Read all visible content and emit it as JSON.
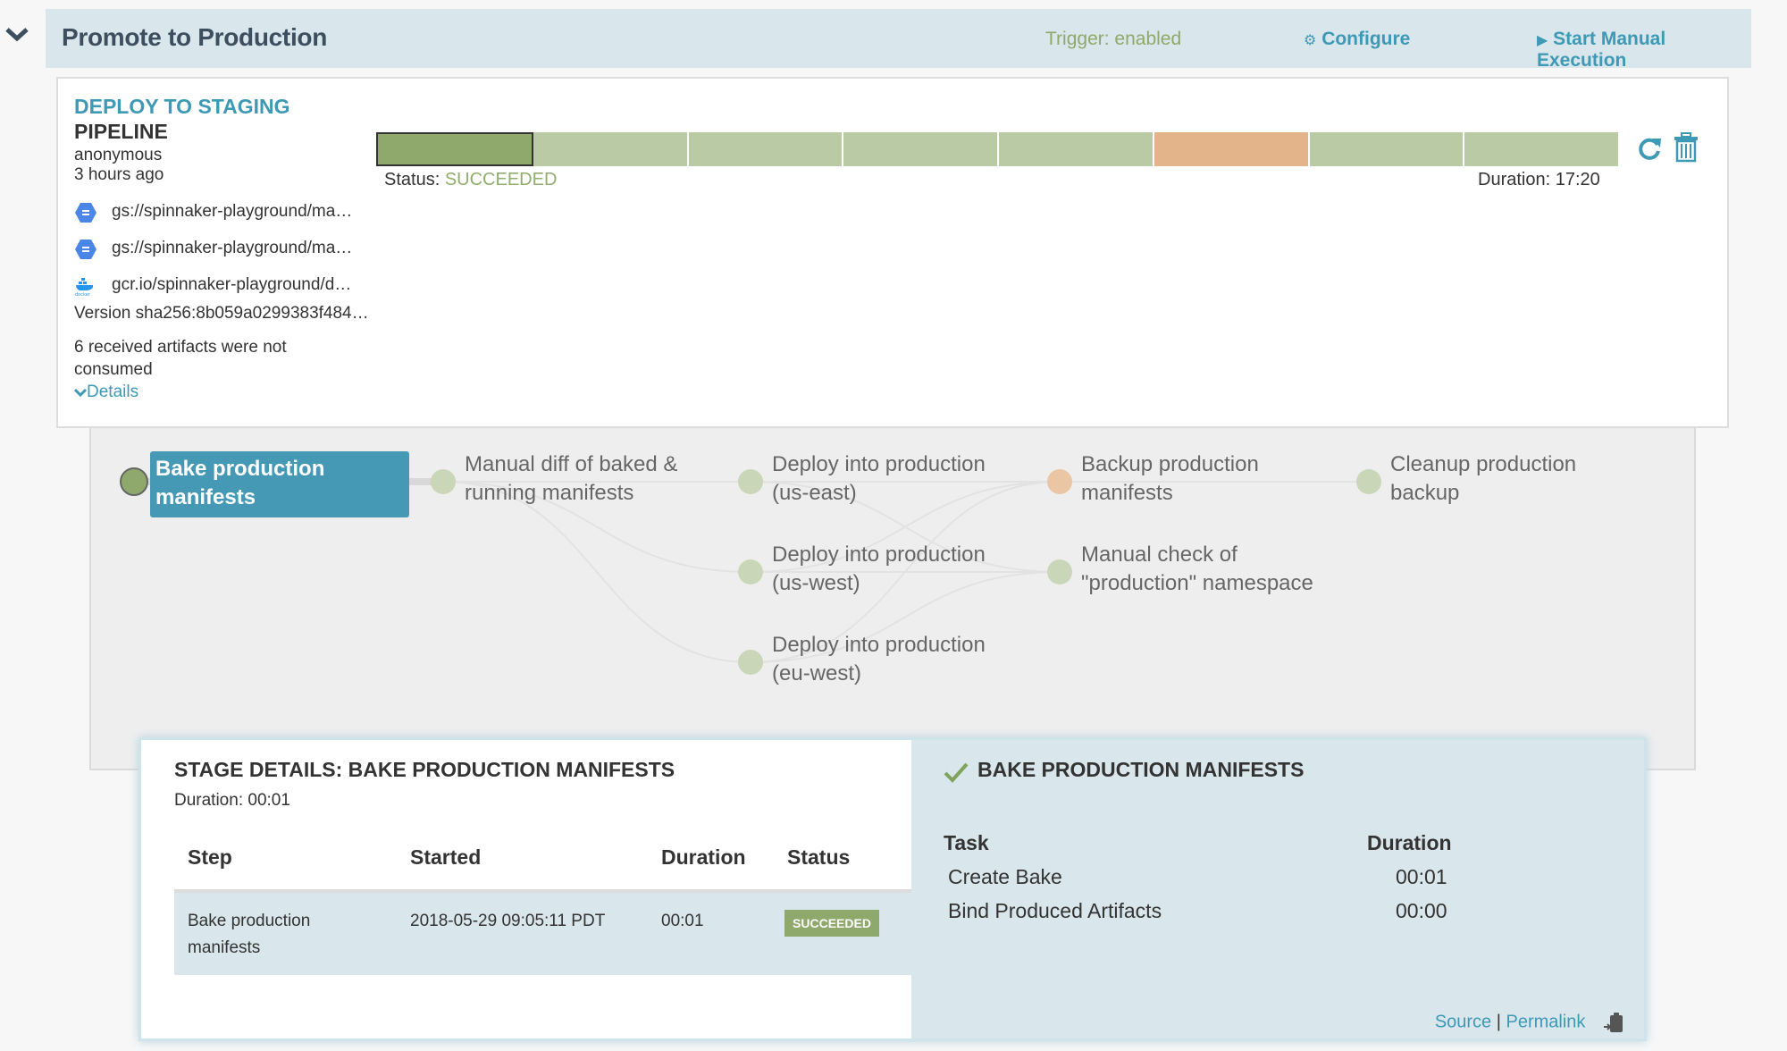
{
  "header": {
    "title": "Promote to Production",
    "trigger_status": "Trigger: enabled",
    "configure_label": "Configure",
    "start_label": "Start Manual Execution",
    "colors": {
      "trigger": "#8fa86b",
      "link": "#3e99b5"
    }
  },
  "execution": {
    "name": "DEPLOY TO STAGING",
    "type": "PIPELINE",
    "user": "anonymous",
    "time_ago": "3 hours ago",
    "artifacts": [
      {
        "icon": "gcs-icon",
        "text": "gs://spinnaker-playground/ma…"
      },
      {
        "icon": "gcs-icon",
        "text": "gs://spinnaker-playground/ma…"
      },
      {
        "icon": "docker-icon",
        "text": "gcr.io/spinnaker-playground/d…"
      }
    ],
    "version_label": "Version",
    "version_value": "sha256:8b059a0299383f484…",
    "unconsumed": "6 received artifacts were not consumed",
    "details_label": "Details",
    "status_label": "Status:",
    "status_value": "SUCCEEDED",
    "duration": "Duration: 17:20",
    "stage_bar": [
      {
        "status": "succeeded",
        "active": true
      },
      {
        "status": "succeeded"
      },
      {
        "status": "succeeded"
      },
      {
        "status": "succeeded"
      },
      {
        "status": "succeeded"
      },
      {
        "status": "skipped"
      },
      {
        "status": "succeeded"
      },
      {
        "status": "succeeded"
      }
    ],
    "colors": {
      "active": "#8fa86b",
      "succeeded": "#bacaa5",
      "skipped": "#e3b48a"
    }
  },
  "graph": {
    "nodes": [
      {
        "id": "bake",
        "label": "Bake production manifests",
        "lines": [
          "Bake production",
          "manifests"
        ],
        "col": 0,
        "row": 0,
        "status": "active"
      },
      {
        "id": "diff",
        "label": "Manual diff of baked & running manifests",
        "lines": [
          "Manual diff of baked &",
          "running manifests"
        ],
        "col": 1,
        "row": 0,
        "status": "succeeded"
      },
      {
        "id": "use",
        "label": "Deploy into production (us-east)",
        "lines": [
          "Deploy into production",
          "(us-east)"
        ],
        "col": 2,
        "row": 0,
        "status": "succeeded"
      },
      {
        "id": "usw",
        "label": "Deploy into production (us-west)",
        "lines": [
          "Deploy into production",
          "(us-west)"
        ],
        "col": 2,
        "row": 1,
        "status": "succeeded"
      },
      {
        "id": "euw",
        "label": "Deploy into production (eu-west)",
        "lines": [
          "Deploy into production",
          "(eu-west)"
        ],
        "col": 2,
        "row": 2,
        "status": "succeeded"
      },
      {
        "id": "backup",
        "label": "Backup production manifests",
        "lines": [
          "Backup production",
          "manifests"
        ],
        "col": 3,
        "row": 0,
        "status": "skipped"
      },
      {
        "id": "check",
        "label": "Manual check of \"production\" namespace",
        "lines": [
          "Manual check of",
          "\"production\" namespace"
        ],
        "col": 3,
        "row": 1,
        "status": "succeeded"
      },
      {
        "id": "cleanup",
        "label": "Cleanup production backup",
        "lines": [
          "Cleanup production",
          "backup"
        ],
        "col": 4,
        "row": 0,
        "status": "succeeded"
      }
    ],
    "edges": [
      [
        "bake",
        "diff"
      ],
      [
        "diff",
        "use"
      ],
      [
        "diff",
        "usw"
      ],
      [
        "diff",
        "euw"
      ],
      [
        "use",
        "backup"
      ],
      [
        "usw",
        "backup"
      ],
      [
        "euw",
        "backup"
      ],
      [
        "use",
        "check"
      ],
      [
        "usw",
        "check"
      ],
      [
        "euw",
        "check"
      ],
      [
        "backup",
        "cleanup"
      ]
    ]
  },
  "stage_details": {
    "title": "STAGE DETAILS: BAKE PRODUCTION MANIFESTS",
    "duration": "Duration: 00:01",
    "columns": [
      "Step",
      "Started",
      "Duration",
      "Status"
    ],
    "rows": [
      {
        "step_lines": [
          "Bake production",
          "manifests"
        ],
        "started": "2018-05-29 09:05:11 PDT",
        "duration": "00:01",
        "status": "SUCCEEDED"
      }
    ],
    "task_panel": {
      "title": "BAKE PRODUCTION MANIFESTS",
      "columns": [
        "Task",
        "Duration"
      ],
      "tasks": [
        {
          "name": "Create Bake",
          "duration": "00:01"
        },
        {
          "name": "Bind Produced Artifacts",
          "duration": "00:00"
        }
      ]
    },
    "links": {
      "source": "Source",
      "separator": "|",
      "permalink": "Permalink"
    }
  }
}
